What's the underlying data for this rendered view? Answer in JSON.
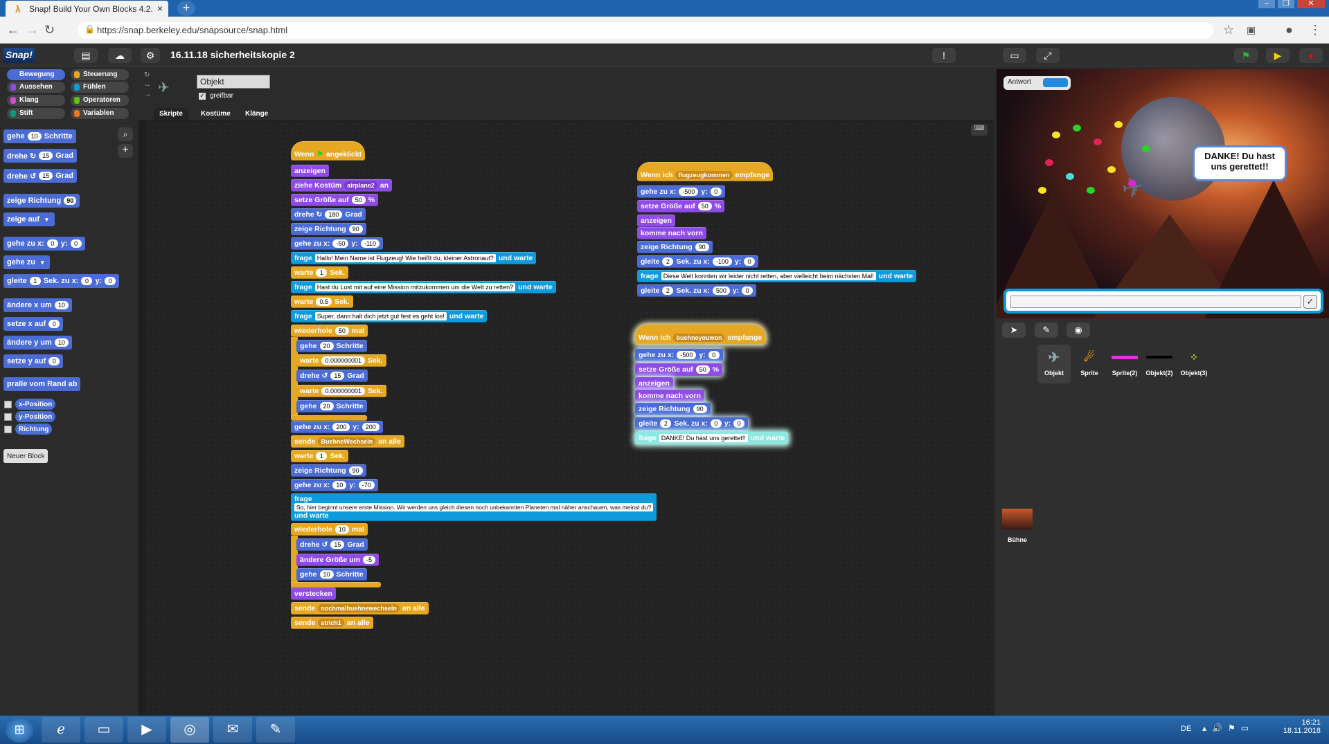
{
  "browser": {
    "tab_title": "Snap! Build Your Own Blocks 4.2.",
    "tab_favicon": "λ",
    "url": "https://snap.berkeley.edu/snapsource/snap.html"
  },
  "snap": {
    "logo": "Snap!",
    "project_name": "16.11.18 sicherheitskopie 2"
  },
  "categories": [
    {
      "label": "Bewegung",
      "color": "#4a6cd4",
      "selected": true
    },
    {
      "label": "Steuerung",
      "color": "#e6a822"
    },
    {
      "label": "Aussehen",
      "color": "#8f4be6"
    },
    {
      "label": "Fühlen",
      "color": "#0d9bdc"
    },
    {
      "label": "Klang",
      "color": "#cf4ad9"
    },
    {
      "label": "Operatoren",
      "color": "#62c213"
    },
    {
      "label": "Stift",
      "color": "#00a178"
    },
    {
      "label": "Variablen",
      "color": "#f3761d"
    }
  ],
  "palette": {
    "b1": {
      "a": "gehe",
      "v": "10",
      "b": "Schritte"
    },
    "b2": {
      "a": "drehe ↻",
      "v": "15",
      "b": "Grad"
    },
    "b3": {
      "a": "drehe ↺",
      "v": "15",
      "b": "Grad"
    },
    "b4": {
      "a": "zeige Richtung",
      "v": "90"
    },
    "b5": {
      "a": "zeige auf"
    },
    "b6": {
      "a": "gehe zu x:",
      "v": "0",
      "b": "y:",
      "v2": "0"
    },
    "b7": {
      "a": "gehe zu"
    },
    "b8": {
      "a": "gleite",
      "v": "1",
      "b": "Sek. zu x:",
      "v2": "0",
      "c": "y:",
      "v3": "0"
    },
    "b9": {
      "a": "ändere x um",
      "v": "10"
    },
    "b10": {
      "a": "setze x auf",
      "v": "0"
    },
    "b11": {
      "a": "ändere y um",
      "v": "10"
    },
    "b12": {
      "a": "setze y auf",
      "v": "0"
    },
    "b13": {
      "a": "pralle vom Rand ab"
    },
    "r1": "x-Position",
    "r2": "y-Position",
    "r3": "Richtung",
    "new_block": "Neuer Block"
  },
  "sprite": {
    "name": "Objekt",
    "draggable_label": "greifbar",
    "tabs": [
      "Skripte",
      "Kostüme",
      "Klänge"
    ]
  },
  "script1": {
    "hat_a": "Wenn",
    "hat_b": "angeklickt",
    "l1": "anzeigen",
    "l2a": "ziehe Kostüm",
    "l2v": "airplane2",
    "l2b": "an",
    "l3a": "setze Größe auf",
    "l3v": "50",
    "l3b": "%",
    "l4a": "drehe ↻",
    "l4v": "180",
    "l4b": "Grad",
    "l5a": "zeige Richtung",
    "l5v": "90",
    "l6a": "gehe zu x:",
    "l6v": "-50",
    "l6b": "y:",
    "l6v2": "-110",
    "l7a": "frage",
    "l7v": "Hallo! Mein Name ist Flugzeug! Wie heißt du, kleiner Astronaut?",
    "l7b": "und warte",
    "l8a": "warte",
    "l8v": "1",
    "l8b": "Sek.",
    "l9a": "frage",
    "l9v": "Hast du Lust mit auf eine Mission mitzukommen um die Welt zu retten?",
    "l9b": "und warte",
    "l10a": "warte",
    "l10v": "0.5",
    "l10b": "Sek.",
    "l11a": "frage",
    "l11v": "Super, dann halt dich jetzt gut fest es geht los!",
    "l11b": "und warte",
    "l12a": "wiederhole",
    "l12v": "50",
    "l12b": "mal",
    "l13a": "gehe",
    "l13v": "20",
    "l13b": "Schritte",
    "l14a": "warte",
    "l14v": "0.000000001",
    "l14b": "Sek.",
    "l15a": "drehe ↺",
    "l15v": "15",
    "l15b": "Grad",
    "l16a": "warte",
    "l16v": "0.000000001",
    "l16b": "Sek.",
    "l17a": "gehe",
    "l17v": "20",
    "l17b": "Schritte",
    "l18a": "gehe zu x:",
    "l18v": "200",
    "l18b": "y:",
    "l18v2": "200",
    "l19a": "sende",
    "l19v": "BuehneWechseln",
    "l19b": "an alle",
    "l20a": "warte",
    "l20v": "1",
    "l20b": "Sek.",
    "l21a": "zeige Richtung",
    "l21v": "90",
    "l22a": "gehe zu x:",
    "l22v": "10",
    "l22b": "y:",
    "l22v2": "-70",
    "l23a": "frage",
    "l23v": "So, hier beginnt unsere erste Mission. Wir werden uns gleich diesen noch unbekannten Planeten mal näher anschauen, was meinst du?",
    "l23b": "und warte",
    "l24a": "wiederhole",
    "l24v": "10",
    "l24b": "mal",
    "l25a": "drehe ↺",
    "l25v": "15",
    "l25b": "Grad",
    "l26a": "ändere Größe um",
    "l26v": "-5",
    "l27a": "gehe",
    "l27v": "10",
    "l27b": "Schritte",
    "l28": "verstecken",
    "l29a": "sende",
    "l29v": "nochmalbuehnewechseln",
    "l29b": "an alle",
    "l30a": "sende",
    "l30v": "strich1",
    "l30b": "an alle"
  },
  "script2": {
    "hat_a": "Wenn ich",
    "hat_v": "flugzeugkommen",
    "hat_b": "empfange",
    "l1a": "gehe zu x:",
    "l1v": "-500",
    "l1b": "y:",
    "l1v2": "0",
    "l2a": "setze Größe auf",
    "l2v": "50",
    "l2b": "%",
    "l3": "anzeigen",
    "l4": "komme nach vorn",
    "l5a": "zeige Richtung",
    "l5v": "90",
    "l6a": "gleite",
    "l6v": "2",
    "l6b": "Sek. zu x:",
    "l6v2": "-100",
    "l6c": "y:",
    "l6v3": "0",
    "l7a": "frage",
    "l7v": "Diese Welt konnten wir leider nicht retten, aber vielleicht beim nächsten Mal!",
    "l7b": "und warte",
    "l8a": "gleite",
    "l8v": "2",
    "l8b": "Sek. zu x:",
    "l8v2": "500",
    "l8c": "y:",
    "l8v3": "0"
  },
  "script3": {
    "hat_a": "Wenn ich",
    "hat_v": "buehneyouwon",
    "hat_b": "empfange",
    "l1a": "gehe zu x:",
    "l1v": "-500",
    "l1b": "y:",
    "l1v2": "0",
    "l2a": "setze Größe auf",
    "l2v": "50",
    "l2b": "%",
    "l3": "anzeigen",
    "l4": "komme nach vorn",
    "l5a": "zeige Richtung",
    "l5v": "90",
    "l6a": "gleite",
    "l6v": "2",
    "l6b": "Sek. zu x:",
    "l6v2": "0",
    "l6c": "y:",
    "l6v3": "0",
    "l7a": "frage",
    "l7v": "DANKE! Du hast uns gerettet!!",
    "l7b": "und warte"
  },
  "stage": {
    "watcher_label": "Antwort",
    "bubble": "DANKE! Du hast uns gerettet!!",
    "ok": "✓"
  },
  "corral": {
    "sprites": [
      "Objekt",
      "Sprite",
      "Sprite(2)",
      "Objekt(2)",
      "Objekt(3)"
    ],
    "stage_label": "Bühne"
  },
  "taskbar": {
    "lang": "DE",
    "time": "16:21",
    "date": "18.11.2018"
  }
}
